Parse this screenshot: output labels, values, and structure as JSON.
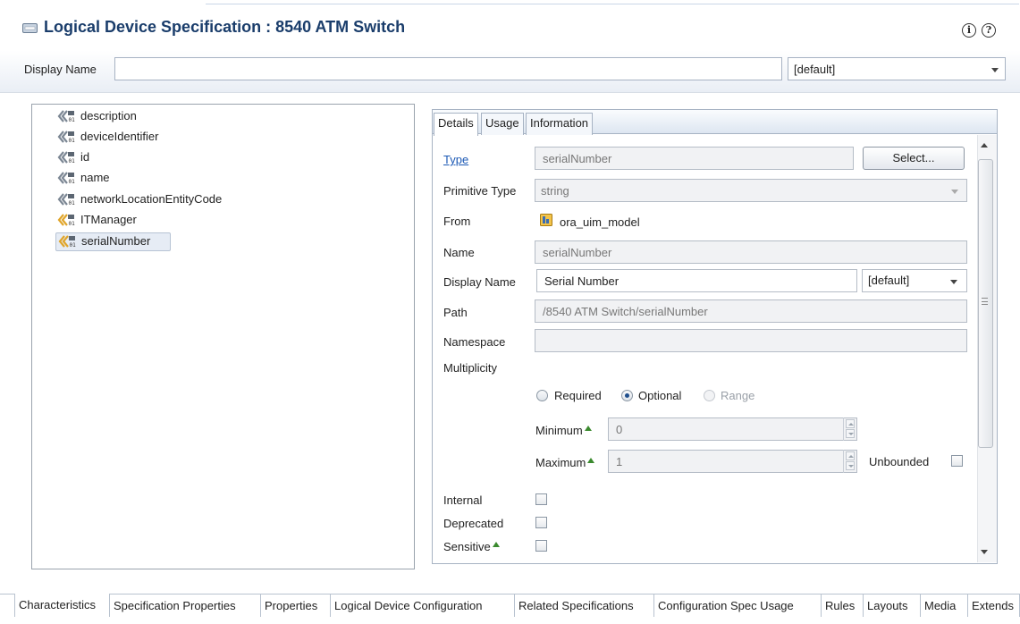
{
  "header": {
    "title": "Logical Device Specification : 8540 ATM Switch",
    "info_icon": "info-icon",
    "help_icon": "help-icon",
    "display_name_label": "Display Name",
    "display_name_value": "",
    "locale_value": "[default]"
  },
  "tree": {
    "items": [
      {
        "label": "description",
        "icon": "attribute-icon"
      },
      {
        "label": "deviceIdentifier",
        "icon": "attribute-icon"
      },
      {
        "label": "id",
        "icon": "attribute-icon"
      },
      {
        "label": "name",
        "icon": "attribute-icon"
      },
      {
        "label": "networkLocationEntityCode",
        "icon": "attribute-icon"
      },
      {
        "label": "ITManager",
        "icon": "characteristic-icon"
      },
      {
        "label": "serialNumber",
        "icon": "characteristic-icon",
        "selected": true
      }
    ]
  },
  "detail_tabs": [
    "Details",
    "Usage",
    "Information"
  ],
  "details": {
    "type_label": "Type",
    "type_value": "serialNumber",
    "select_button": "Select...",
    "primitive_type_label": "Primitive Type",
    "primitive_type_value": "string",
    "from_label": "From",
    "from_value": "ora_uim_model",
    "name_label": "Name",
    "name_value": "serialNumber",
    "display_name_label": "Display Name",
    "display_name_value": "Serial Number",
    "display_name_locale": "[default]",
    "path_label": "Path",
    "path_value": "/8540 ATM Switch/serialNumber",
    "namespace_label": "Namespace",
    "namespace_value": "",
    "multiplicity_label": "Multiplicity",
    "required_label": "Required",
    "optional_label": "Optional",
    "range_label": "Range",
    "selected_multiplicity": "Optional",
    "minimum_label": "Minimum",
    "minimum_value": "0",
    "maximum_label": "Maximum",
    "maximum_value": "1",
    "unbounded_label": "Unbounded",
    "internal_label": "Internal",
    "deprecated_label": "Deprecated",
    "sensitive_label": "Sensitive"
  },
  "bottom_tabs": [
    "Characteristics",
    "Specification Properties",
    "Properties",
    "Logical Device Configuration",
    "Related Specifications",
    "Configuration Spec Usage",
    "Rules",
    "Layouts",
    "Media",
    "Extends"
  ],
  "colors": {
    "title": "#1a3d6b",
    "link": "#1c59b5",
    "selected_row": "#e6ecf5"
  }
}
